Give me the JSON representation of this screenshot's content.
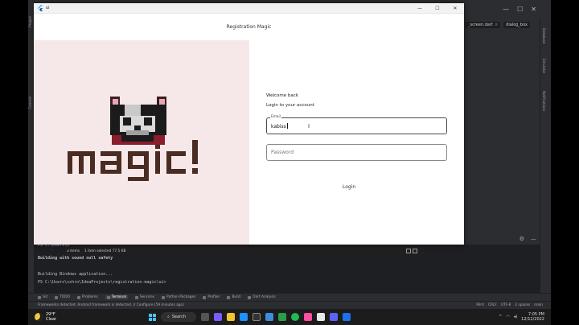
{
  "app_window": {
    "title": "ui",
    "appbar_title": "Registration Magic",
    "controls": [
      "—",
      "☐",
      "✕"
    ]
  },
  "login_form": {
    "welcome": "Welcome back",
    "subtitle": "Login to your account",
    "email_label": "Email",
    "email_value": "kabiss",
    "password_placeholder": "Password",
    "login_label": "Login"
  },
  "ide": {
    "right_tabs": [
      "_screen.dart",
      "dialog_box"
    ],
    "terminal_lines": [
      "PS C:\\Users\\s",
      "Building with sound null safety",
      "Building Bindows application...",
      "PS C:\\Users\\schro\\IdeaProjects\\registration-magic\\ui>"
    ],
    "explorer_status": [
      "3 items",
      "1 item selected  77.5 KB"
    ],
    "toolbar_items": [
      "Git",
      "TODO",
      "Problems",
      "Terminal",
      "Services",
      "Python Packages",
      "Profiler",
      "Build",
      "Dart Analysis"
    ],
    "active_tool": "Terminal",
    "status_message": "Frameworks detected: Android framework is detected. // Configure (59 minutes ago)",
    "status_right": [
      "99:4",
      "CRLF",
      "UTF-8",
      "2 spaces",
      "main"
    ]
  },
  "taskbar": {
    "temperature": "29°F",
    "condition": "Clear",
    "search_label": "Search",
    "time": "7:05 PM",
    "date": "12/12/2022",
    "accent": "#4cc2ff"
  }
}
